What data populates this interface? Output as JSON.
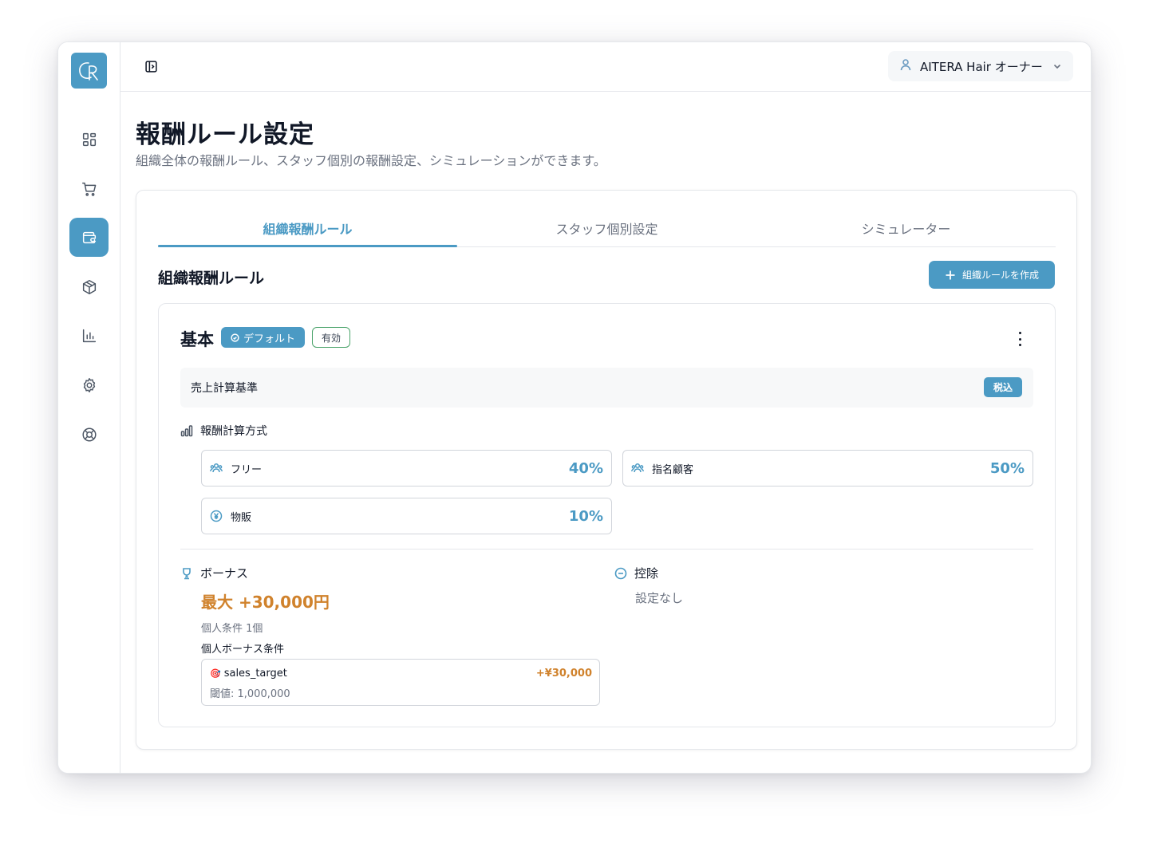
{
  "app": {
    "logo_text": "GR"
  },
  "sidebar": {
    "items": [
      {
        "name": "dashboard",
        "icon": "grid-icon",
        "active": false
      },
      {
        "name": "cart",
        "icon": "cart-icon",
        "active": false
      },
      {
        "name": "wallet",
        "icon": "wallet-icon",
        "active": true
      },
      {
        "name": "products",
        "icon": "box-icon",
        "active": false
      },
      {
        "name": "analytics",
        "icon": "bar-chart-icon",
        "active": false
      },
      {
        "name": "settings",
        "icon": "gear-icon",
        "active": false
      },
      {
        "name": "support",
        "icon": "lifebuoy-icon",
        "active": false
      }
    ]
  },
  "header": {
    "user_label": "AITERA Hair オーナー"
  },
  "page": {
    "title": "報酬ルール設定",
    "subtitle": "組織全体の報酬ルール、スタッフ個別の報酬設定、シミュレーションができます。"
  },
  "tabs": [
    {
      "label": "組織報酬ルール",
      "active": true
    },
    {
      "label": "スタッフ個別設定",
      "active": false
    },
    {
      "label": "シミュレーター",
      "active": false
    }
  ],
  "section": {
    "title": "組織報酬ルール",
    "create_button": "組織ルールを作成"
  },
  "rule": {
    "name": "基本",
    "badge_default": "デフォルト",
    "badge_active": "有効",
    "basis_label": "売上計算基準",
    "basis_value": "税込",
    "method_title": "報酬計算方式",
    "rates": [
      {
        "label": "フリー",
        "value": "40%",
        "icon": "users-icon"
      },
      {
        "label": "指名顧客",
        "value": "50%",
        "icon": "users-icon"
      },
      {
        "label": "物販",
        "value": "10%",
        "icon": "yen-icon"
      }
    ],
    "bonus": {
      "title": "ボーナス",
      "max_amount": "最大 +30,000円",
      "count": "個人条件 1個",
      "condition_title": "個人ボーナス条件",
      "conditions": [
        {
          "name": "sales_target",
          "threshold": "閾値: 1,000,000",
          "amount": "+¥30,000"
        }
      ]
    },
    "deduction": {
      "title": "控除",
      "value": "設定なし"
    }
  },
  "colors": {
    "accent": "#4b9ac4",
    "bonus": "#d0822c",
    "active_border": "#4aa36a"
  }
}
